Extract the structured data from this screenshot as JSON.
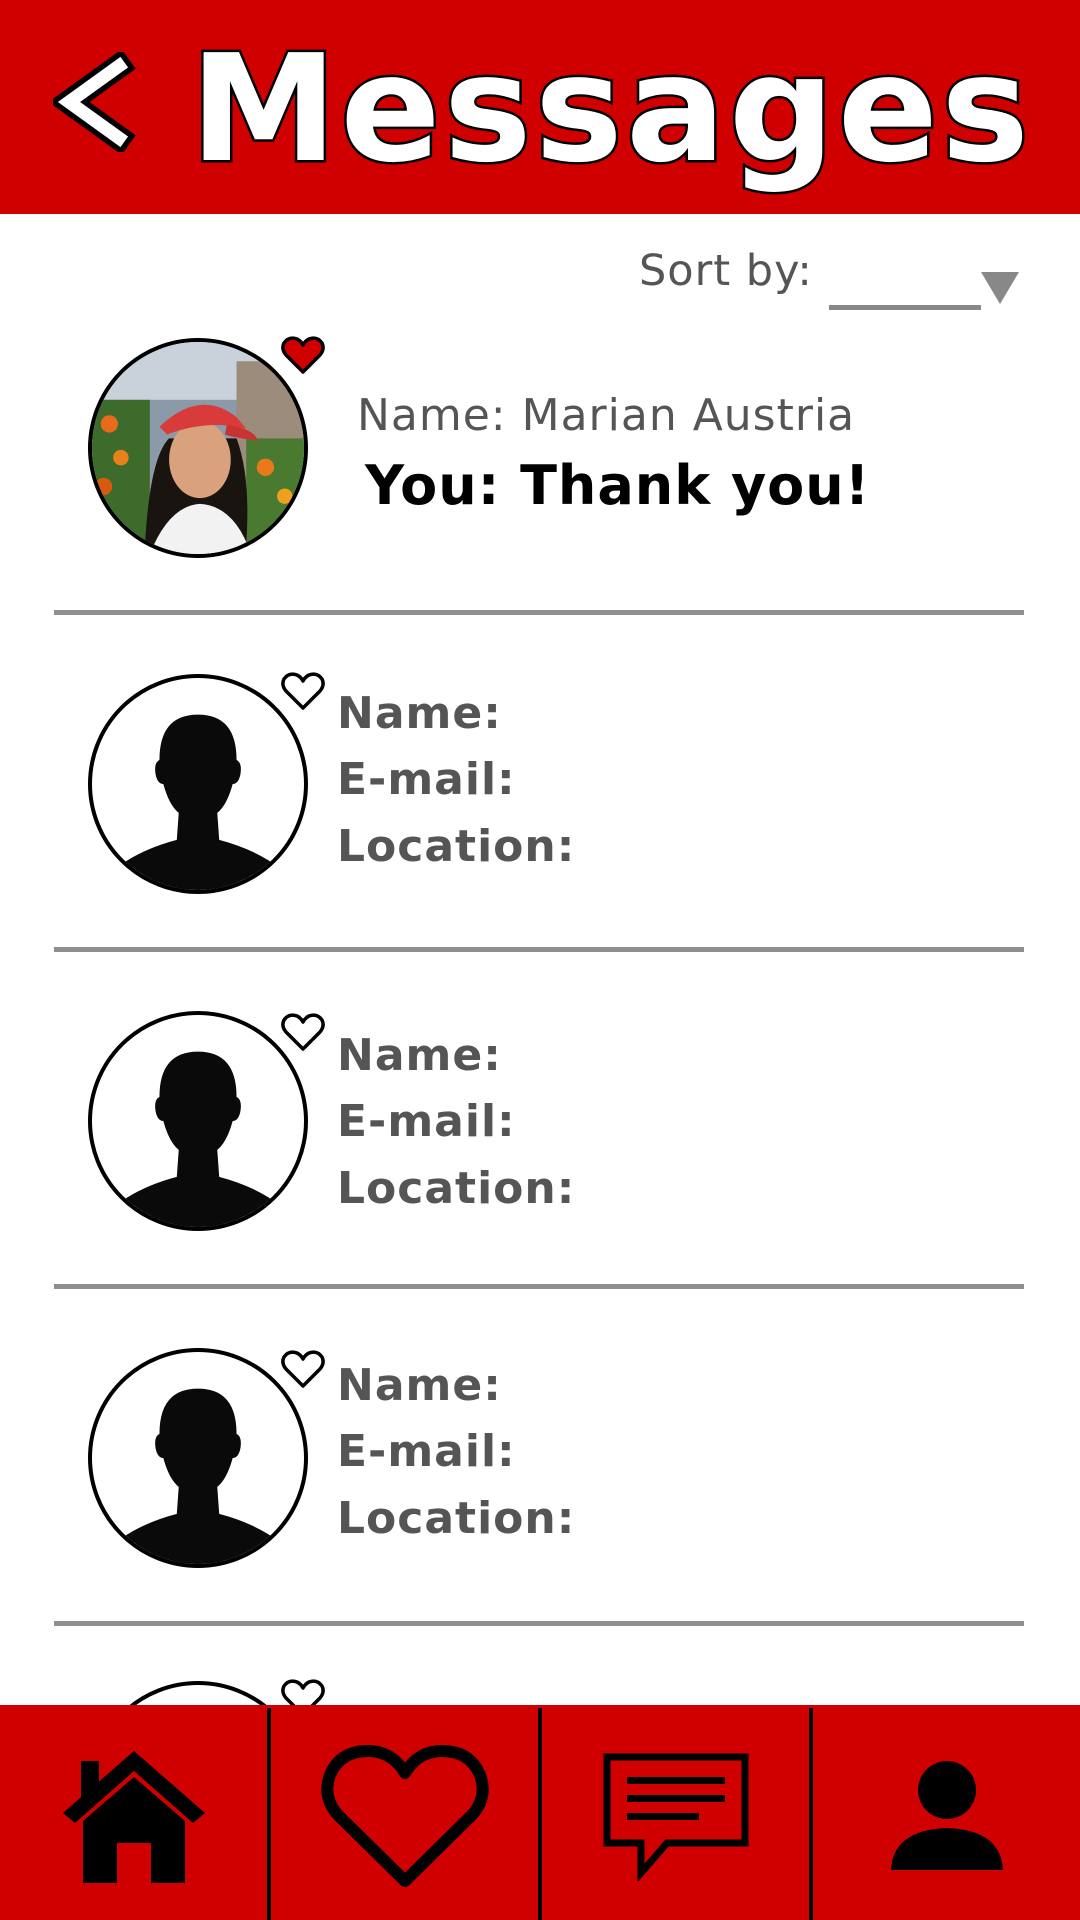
{
  "header": {
    "title": "Messages",
    "back_icon": "chevron-left-icon"
  },
  "sort": {
    "label": "Sort by:",
    "selected": ""
  },
  "contacts": [
    {
      "name_line": "Name: Marian Austria",
      "last_message": "You: Thank you!",
      "favorited": true,
      "avatar": "photo"
    },
    {
      "name_label": "Name:",
      "email_label": "E-mail:",
      "location_label": "Location:",
      "favorited": false,
      "avatar": "silhouette"
    },
    {
      "name_label": "Name:",
      "email_label": "E-mail:",
      "location_label": "Location:",
      "favorited": false,
      "avatar": "silhouette"
    },
    {
      "name_label": "Name:",
      "email_label": "E-mail:",
      "location_label": "Location:",
      "favorited": false,
      "avatar": "silhouette"
    },
    {
      "favorited": false,
      "avatar": "silhouette"
    }
  ],
  "bottom_nav": [
    {
      "icon": "home-icon"
    },
    {
      "icon": "heart-icon"
    },
    {
      "icon": "message-icon"
    },
    {
      "icon": "profile-icon"
    }
  ],
  "colors": {
    "brand_red": "#d10000",
    "divider_gray": "#8f8f8f",
    "text_gray": "#555555"
  }
}
